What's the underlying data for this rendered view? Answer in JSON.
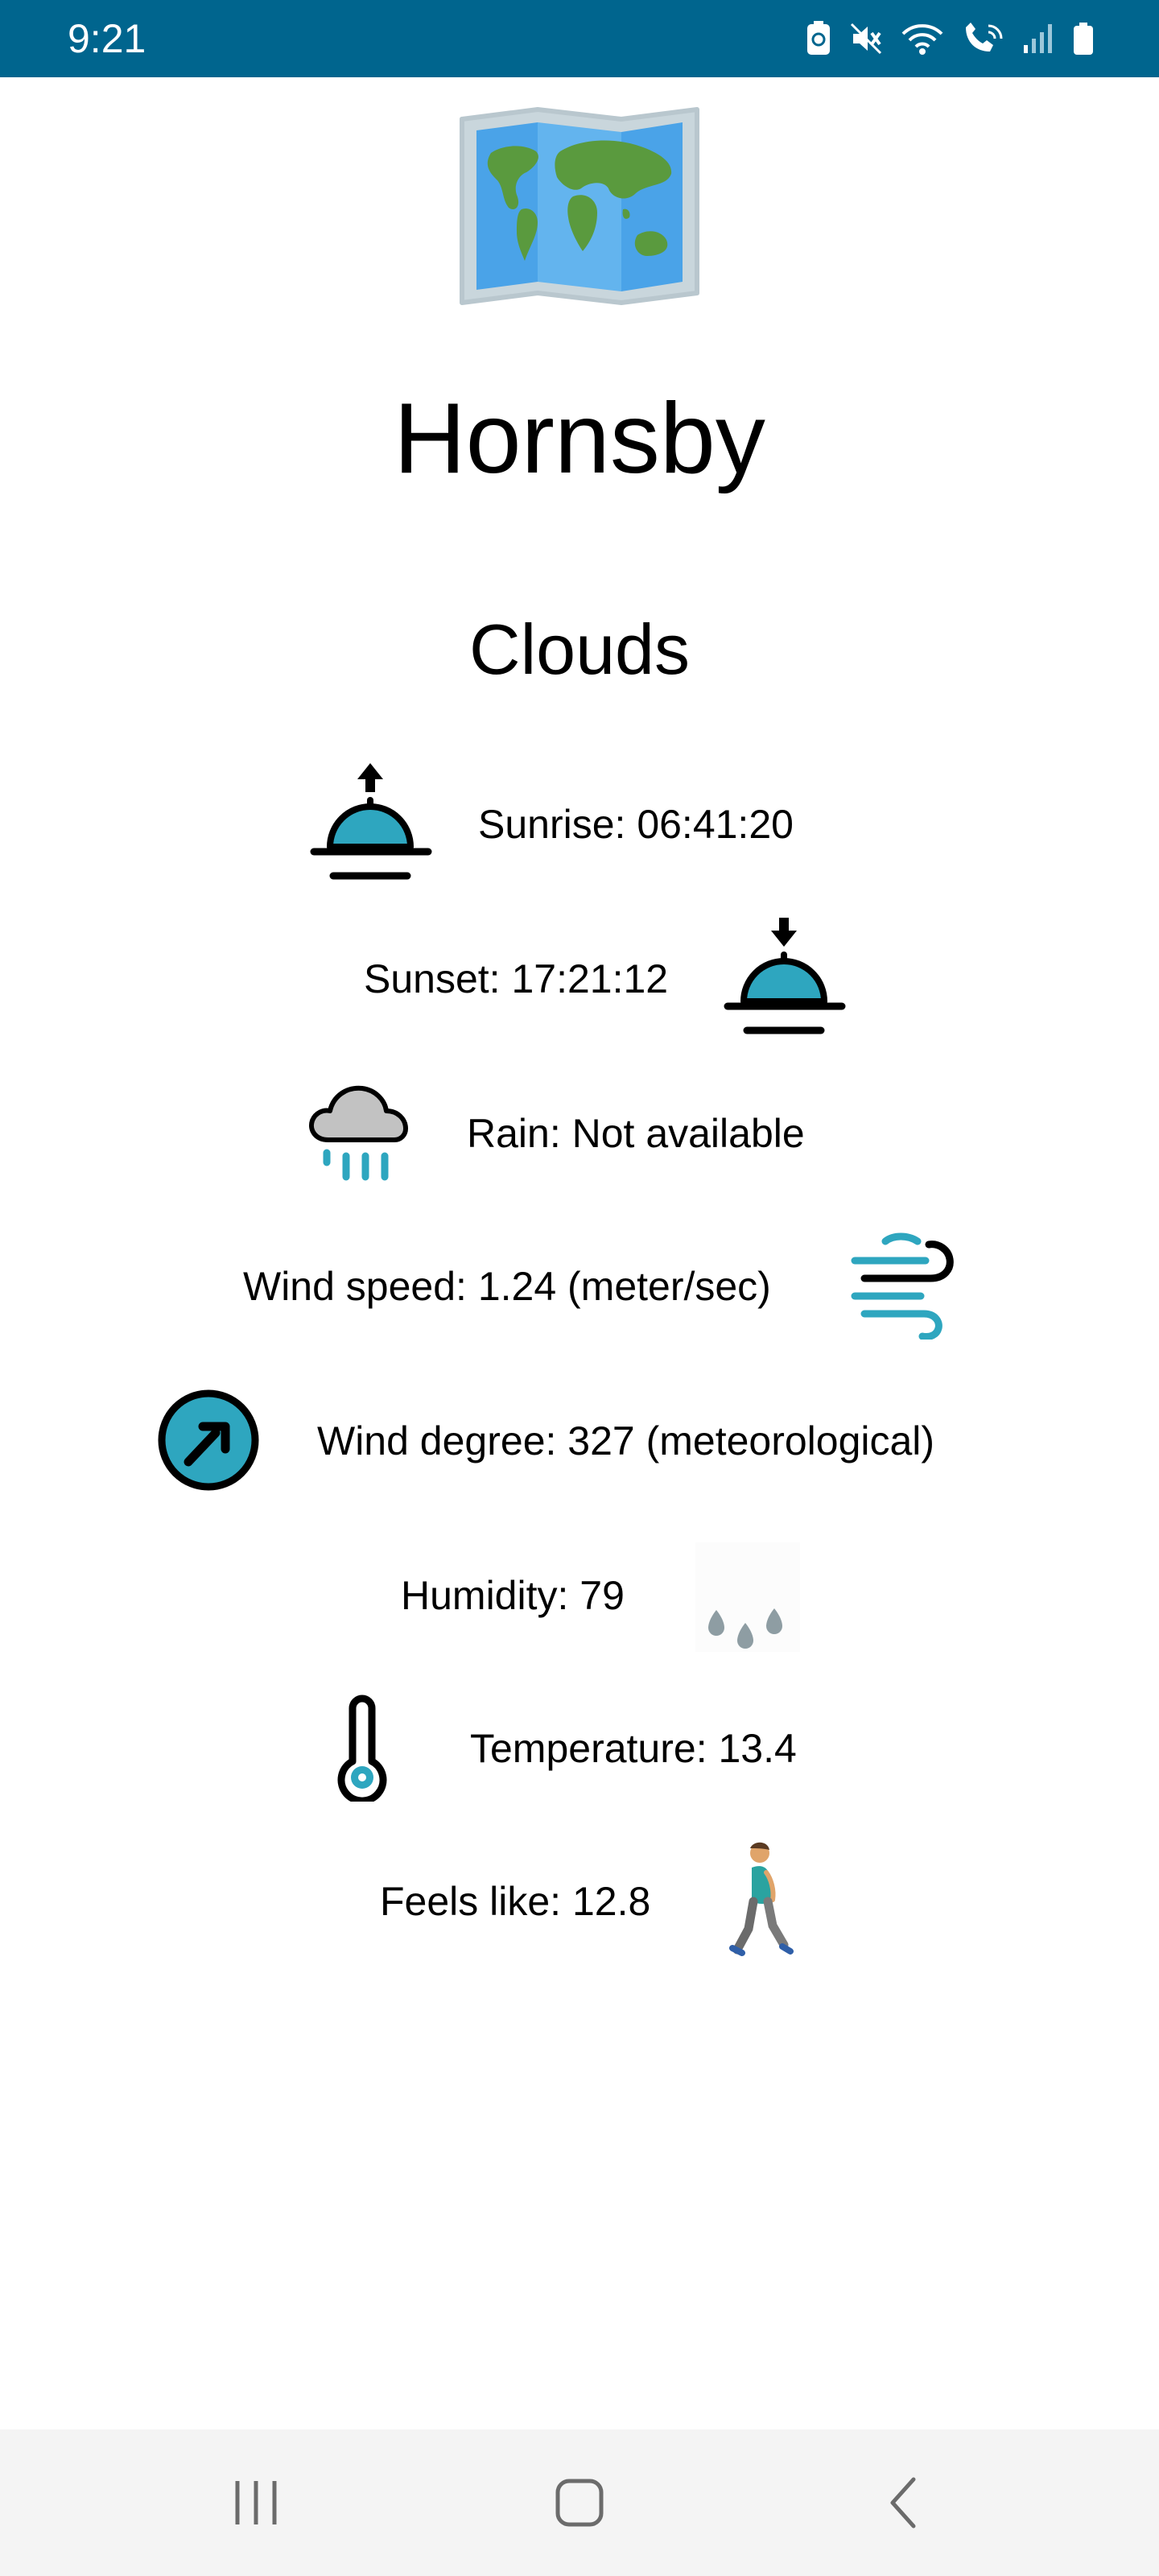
{
  "status_bar": {
    "time": "9:21",
    "icons": [
      "data-saver-icon",
      "mute-icon",
      "wifi-icon",
      "wifi-call-icon",
      "signal-icon",
      "battery-icon"
    ]
  },
  "header": {
    "logo_icon": "world-map-icon",
    "city": "Hornsby",
    "condition": "Clouds"
  },
  "weather": {
    "sunrise": "Sunrise: 06:41:20",
    "sunset": "Sunset: 17:21:12",
    "rain": "Rain: Not available",
    "wind_speed": "Wind speed: 1.24 (meter/sec)",
    "wind_degree": "Wind degree: 327 (meteorological)",
    "humidity": "Humidity: 79",
    "temperature": "Temperature: 13.4",
    "feels_like": "Feels like: 12.8"
  },
  "colors": {
    "status_bar": "#00658e",
    "accent_teal": "#2ea6bf",
    "nav_bar": "#f4f4f4"
  },
  "nav": {
    "buttons": [
      "recent-apps-button",
      "home-button",
      "back-button"
    ]
  }
}
